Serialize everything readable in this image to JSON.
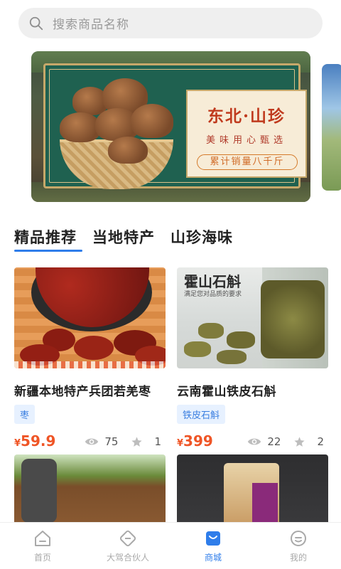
{
  "search": {
    "placeholder": "搜索商品名称"
  },
  "banner": {
    "title": "东北·山珍",
    "subtitle": "美味用心甄选",
    "badge": "累计销量八千斤"
  },
  "tabs": [
    {
      "label": "精品推荐",
      "active": true
    },
    {
      "label": "当地特产",
      "active": false
    },
    {
      "label": "山珍海味",
      "active": false
    }
  ],
  "products": [
    {
      "name": "新疆本地特产兵团若羌枣",
      "tag": "枣",
      "currency": "¥",
      "price": "59.9",
      "views": "75",
      "stars": "1",
      "image_text": ""
    },
    {
      "name": "云南霍山铁皮石斛",
      "tag": "铁皮石斛",
      "currency": "¥",
      "price": "399",
      "views": "22",
      "stars": "2",
      "image_text": "霍山石斛",
      "image_subtext": "满足您对品质的要求"
    }
  ],
  "bottom_nav": [
    {
      "label": "首页",
      "icon": "home-icon",
      "active": false
    },
    {
      "label": "大驾合伙人",
      "icon": "partner-icon",
      "active": false
    },
    {
      "label": "商城",
      "icon": "shop-icon",
      "active": true
    },
    {
      "label": "我的",
      "icon": "profile-icon",
      "active": false
    }
  ],
  "colors": {
    "accent": "#2f7dea",
    "price": "#ef5526",
    "tag_bg": "#e7f1ff"
  }
}
